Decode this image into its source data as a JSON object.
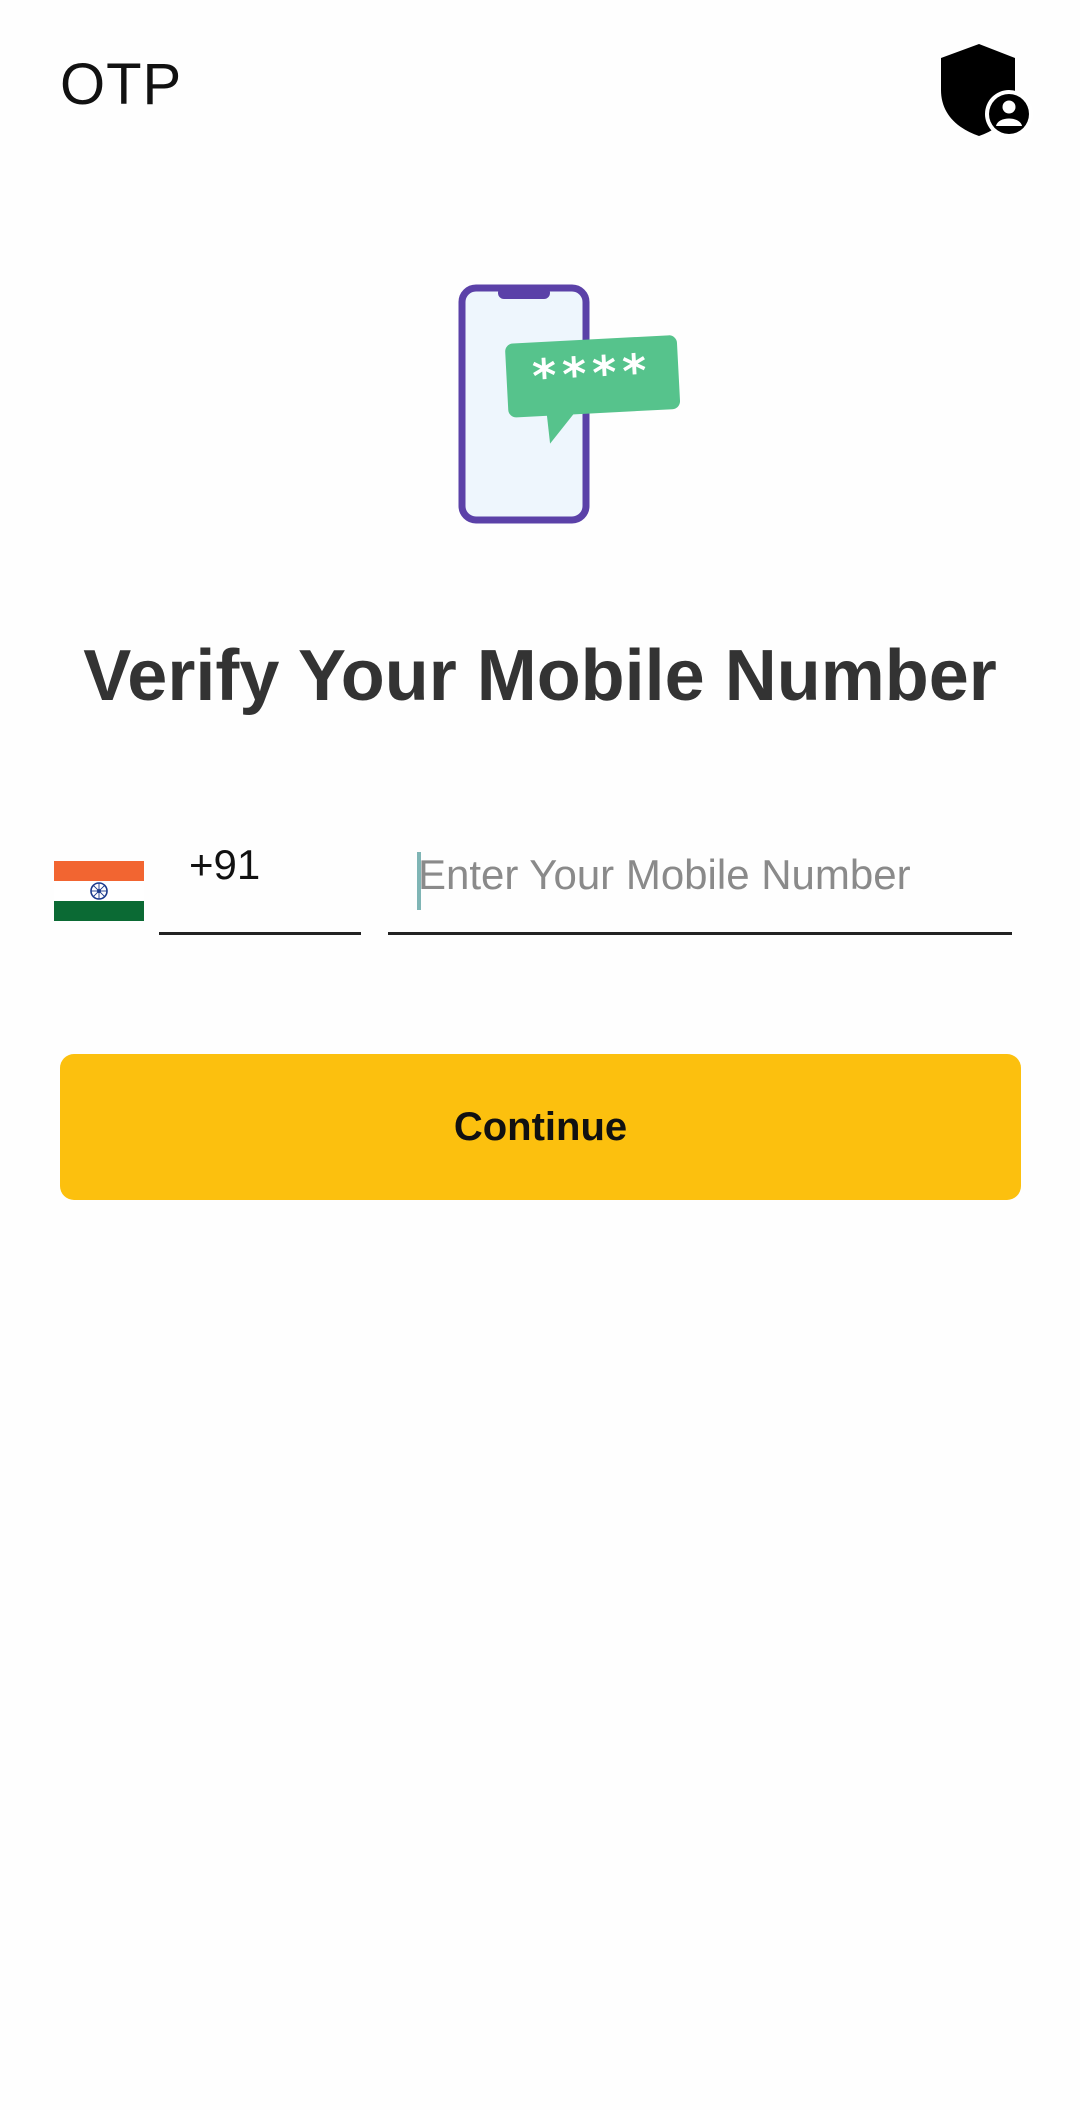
{
  "app_bar": {
    "title": "OTP",
    "action_icon": "shield-user-icon"
  },
  "illustration": {
    "icon": "phone-otp-message-icon",
    "message_text": "****",
    "colors": {
      "phone_frame": "#5b41a8",
      "phone_screen": "#eef6fd",
      "bubble": "#56c38c"
    }
  },
  "heading": "Verify Your Mobile Number",
  "phone_form": {
    "country_flag": "india-flag-icon",
    "country_code": "+91",
    "mobile_value": "",
    "mobile_placeholder": "Enter Your Mobile Number"
  },
  "continue_button": {
    "label": "Continue",
    "color": "#fcc00e"
  }
}
